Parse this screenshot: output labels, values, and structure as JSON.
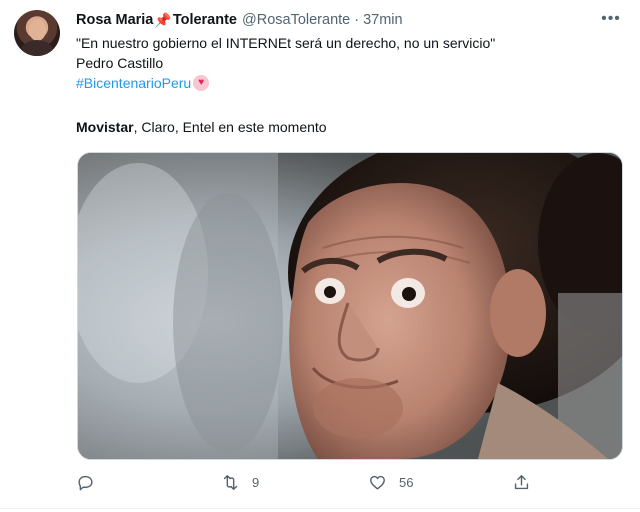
{
  "tweet": {
    "author_name": "Rosa Maria",
    "author_name_suffix": "Tolerante",
    "pin_icon": "pushpin-icon",
    "handle": "@RosaTolerante",
    "separator": "·",
    "time": "37min",
    "more_label": "•••",
    "quote_line": "\"En nuestro gobierno el INTERNEt será un derecho, no un servicio\"",
    "author_line": "Pedro Castillo",
    "hashtag": "#BicentenarioPeru",
    "caption_bold": "Movistar",
    "caption_rest": ", Claro, Entel en este momento"
  },
  "actions": {
    "reply_count": "",
    "retweet_count": "9",
    "like_count": "56"
  },
  "colors": {
    "link": "#1d9bf0",
    "secondary_text": "#536471",
    "primary_text": "#0f1419"
  }
}
